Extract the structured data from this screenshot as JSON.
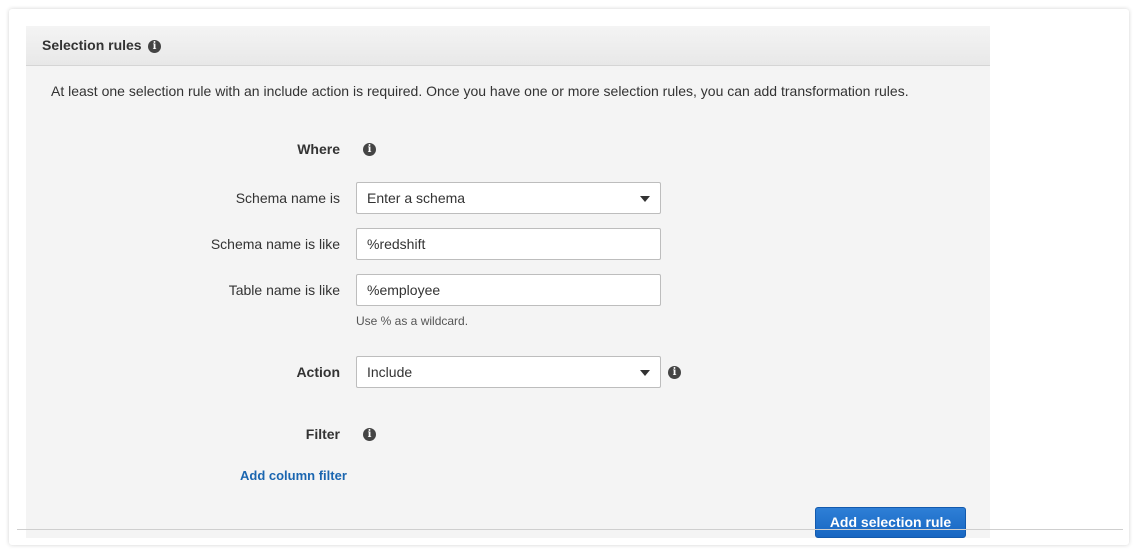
{
  "panel": {
    "title": "Selection rules",
    "description": "At least one selection rule with an include action is required. Once you have one or more selection rules, you can add transformation rules."
  },
  "where": {
    "label": "Where"
  },
  "schema_name": {
    "label": "Schema name is",
    "value": "Enter a schema"
  },
  "schema_like": {
    "label": "Schema name is like",
    "value": "%redshift"
  },
  "table_like": {
    "label": "Table name is like",
    "value": "%employee",
    "hint": "Use % as a wildcard."
  },
  "action": {
    "label": "Action",
    "value": "Include"
  },
  "filter": {
    "label": "Filter",
    "add_link": "Add column filter"
  },
  "buttons": {
    "add_rule": "Add selection rule"
  },
  "icons": {
    "info": "i",
    "info_name": "info-icon",
    "dropdown_name": "chevron-down-icon"
  },
  "colors": {
    "primary": "#1766c2",
    "link": "#1b66b0",
    "panel_bg": "#f4f4f4"
  }
}
